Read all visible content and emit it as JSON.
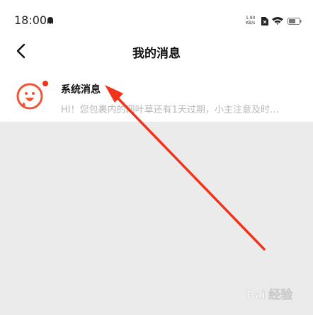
{
  "status_bar": {
    "time": "18:00",
    "network_speed_value": "1.90",
    "network_speed_unit": "KB/s",
    "icons": [
      "ghost-icon",
      "sim-icon",
      "wifi-icon",
      "battery-icon"
    ]
  },
  "nav": {
    "back_icon": "back-arrow-icon",
    "title": "我的消息"
  },
  "messages": [
    {
      "title": "系统消息",
      "preview": "HI！您包裹内的四叶草还有1天过期，小主注意及时…",
      "unread": true,
      "avatar_icon": "mascot-avatar-icon"
    }
  ],
  "annotation": {
    "arrow_color": "#f2331c"
  },
  "watermark": {
    "text": "Bai 经验"
  },
  "colors": {
    "page_bg": "#ebebeb",
    "card_bg": "#ffffff",
    "unread_dot": "#f2331c",
    "avatar_ring": "#f0553a",
    "preview_text": "#b8b8b8"
  }
}
